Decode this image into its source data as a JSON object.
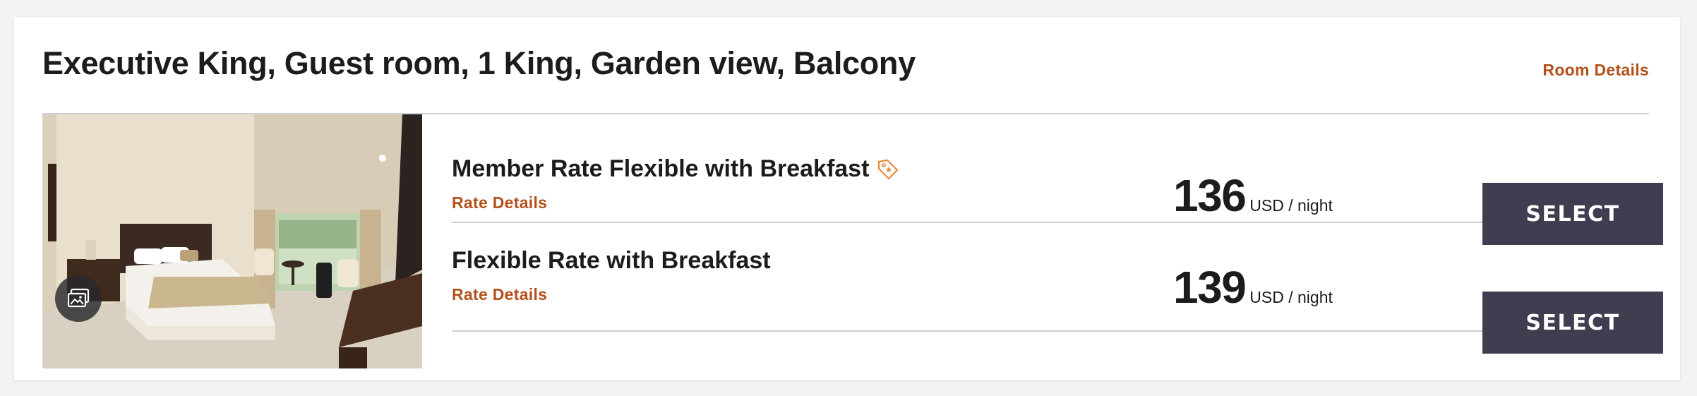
{
  "room": {
    "title": "Executive King, Guest room, 1 King, Garden view, Balcony",
    "details_link": "Room Details"
  },
  "gallery": {
    "icon": "gallery-icon"
  },
  "rates": [
    {
      "name": "Member Rate Flexible with Breakfast",
      "has_member_tag": true,
      "tag_icon": "member-tag-icon",
      "details_link": "Rate Details",
      "price": "136",
      "unit": "USD / night",
      "select_label": "SELECT"
    },
    {
      "name": "Flexible Rate with Breakfast",
      "has_member_tag": false,
      "details_link": "Rate Details",
      "price": "139",
      "unit": "USD / night",
      "select_label": "SELECT"
    }
  ],
  "colors": {
    "accent_link": "#b3501b",
    "button_bg": "#3f3d4f",
    "tag_orange": "#e8893a"
  }
}
